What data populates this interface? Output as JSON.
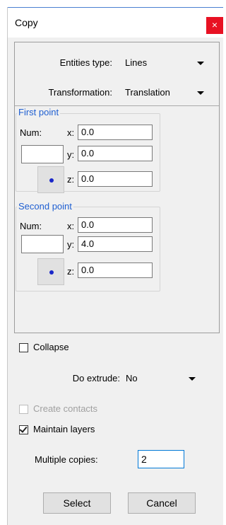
{
  "window": {
    "title": "Copy",
    "close_glyph": "×"
  },
  "settings": {
    "entities_type_label": "Entities type:",
    "entities_type_value": "Lines",
    "transformation_label": "Transformation:",
    "transformation_value": "Translation"
  },
  "first_point": {
    "title": "First point",
    "num_label": "Num:",
    "num_value": "",
    "x_label": "x:",
    "x_value": "0.0",
    "y_label": "y:",
    "y_value": "0.0",
    "z_label": "z:",
    "z_value": "0.0"
  },
  "second_point": {
    "title": "Second point",
    "num_label": "Num:",
    "num_value": "",
    "x_label": "x:",
    "x_value": "0.0",
    "y_label": "y:",
    "y_value": "4.0",
    "z_label": "z:",
    "z_value": "0.0"
  },
  "options": {
    "collapse_label": "Collapse",
    "collapse_checked": false,
    "do_extrude_label": "Do extrude:",
    "do_extrude_value": "No",
    "create_contacts_label": "Create contacts",
    "create_contacts_enabled": false,
    "maintain_layers_label": "Maintain layers",
    "maintain_layers_checked": true,
    "multiple_copies_label": "Multiple copies:",
    "multiple_copies_value": "2"
  },
  "buttons": {
    "select_label": "Select",
    "cancel_label": "Cancel"
  },
  "colors": {
    "group_title": "#1f5fd1",
    "close_bg": "#e81123",
    "pick_dot": "#1a27c9"
  },
  "icons": {
    "close": "close-icon",
    "dropdown": "chevron-down-icon",
    "pick": "pick-point-icon"
  }
}
